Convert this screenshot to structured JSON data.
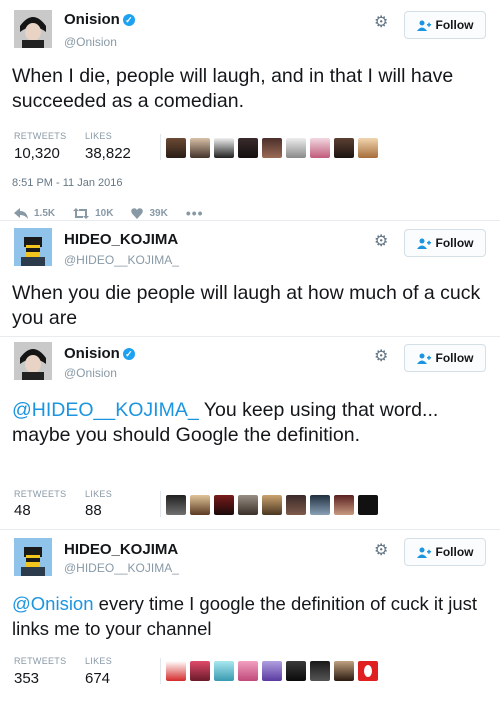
{
  "tweets": [
    {
      "name": "Onision",
      "verified": true,
      "handle": "@Onision",
      "follow_label": "Follow",
      "text": "When I die, people will laugh, and in that I will have succeeded as a comedian.",
      "retweets_label": "RETWEETS",
      "retweets": "10,320",
      "likes_label": "LIKES",
      "likes": "38,822",
      "timestamp": "8:51 PM - 11 Jan 2016",
      "actions": {
        "reply": "1.5K",
        "retweet": "10K",
        "like": "39K"
      }
    },
    {
      "name": "HIDEO_KOJIMA",
      "verified": false,
      "handle": "@HIDEO__KOJIMA_",
      "follow_label": "Follow",
      "text": "When you die people will laugh at how much of a cuck you are"
    },
    {
      "name": "Onision",
      "verified": true,
      "handle": "@Onision",
      "follow_label": "Follow",
      "mention": "@HIDEO__KOJIMA_",
      "text": " You keep using that word... maybe you should Google the definition.",
      "retweets_label": "RETWEETS",
      "retweets": "48",
      "likes_label": "LIKES",
      "likes": "88"
    },
    {
      "name": "HIDEO_KOJIMA",
      "verified": false,
      "handle": "@HIDEO__KOJIMA_",
      "follow_label": "Follow",
      "mention": "@Onision",
      "text": " every time I google the definition of cuck it just links me to your channel",
      "retweets_label": "RETWEETS",
      "retweets": "353",
      "likes_label": "LIKES",
      "likes": "674"
    }
  ],
  "colors": {
    "accent": "#1b95e0",
    "verified": "#1da1f2",
    "muted": "#8899a6"
  },
  "icons": [
    "gear-icon",
    "follow-person-icon",
    "reply-icon",
    "retweet-icon",
    "like-icon",
    "more-icon",
    "verified-icon"
  ]
}
